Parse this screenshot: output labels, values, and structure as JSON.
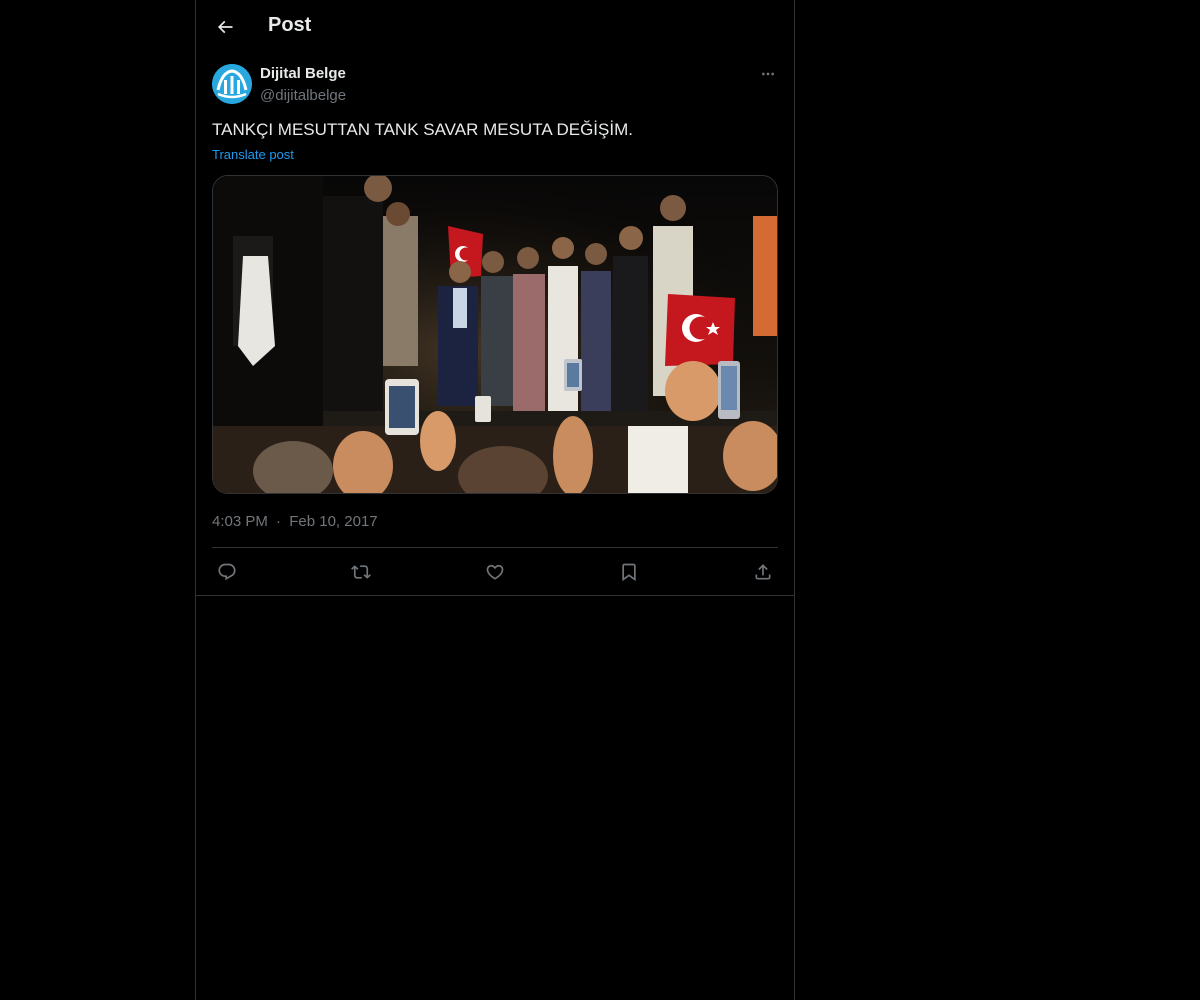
{
  "header": {
    "back_icon": "arrow-left-icon",
    "title": "Post"
  },
  "post": {
    "author": {
      "name": "Dijital Belge",
      "handle": "@dijitalbelge",
      "avatar_icon": "dijital-belge-logo",
      "avatar_color": "#29a8e0"
    },
    "more_icon": "more-horizontal-icon",
    "text": "TANKÇI MESUTTAN TANK SAVAR MESUTA DEĞİŞİM.",
    "translate_label": "Translate post",
    "media": {
      "type": "photo"
    },
    "time": "4:03 PM",
    "separator": "·",
    "date": "Feb 10, 2017",
    "actions": [
      {
        "icon": "reply-icon"
      },
      {
        "icon": "repost-icon"
      },
      {
        "icon": "like-icon"
      },
      {
        "icon": "bookmark-icon"
      },
      {
        "icon": "share-icon"
      }
    ]
  },
  "colors": {
    "background": "#000000",
    "text_primary": "#e7e9ea",
    "text_secondary": "#71767b",
    "link": "#1d9bf0",
    "border": "#2f3336"
  }
}
